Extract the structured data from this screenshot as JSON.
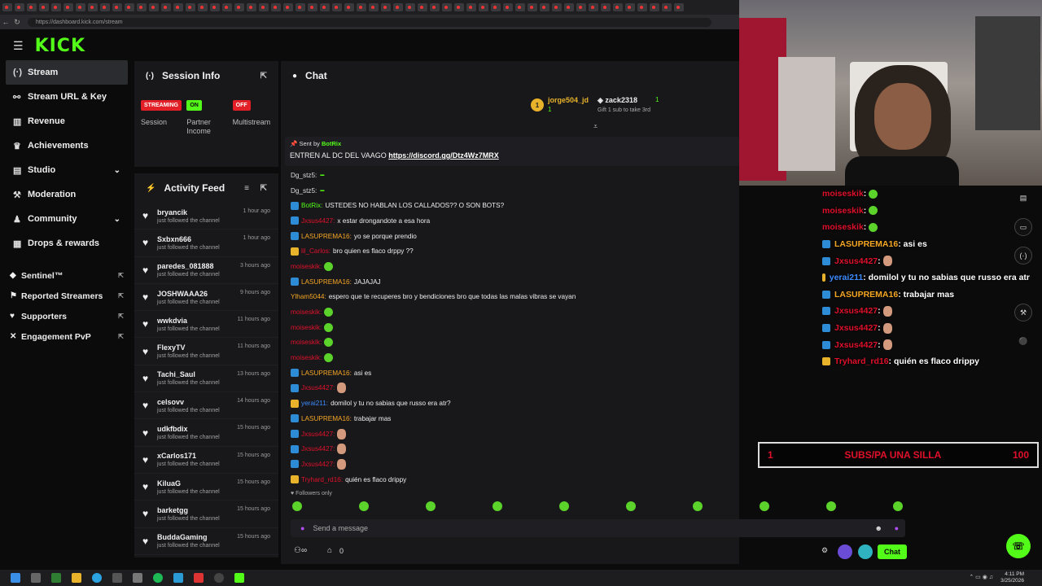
{
  "browser": {
    "url": "https://dashboard.kick.com/stream"
  },
  "brand": {
    "logo": "KICK",
    "accent": "#53fc18"
  },
  "sidebar": {
    "items": [
      {
        "label": "Stream",
        "icon": "stream-icon",
        "active": true
      },
      {
        "label": "Stream URL & Key",
        "icon": "link-icon"
      },
      {
        "label": "Revenue",
        "icon": "revenue-icon"
      },
      {
        "label": "Achievements",
        "icon": "trophy-icon"
      },
      {
        "label": "Studio",
        "icon": "studio-icon",
        "expandable": true
      },
      {
        "label": "Moderation",
        "icon": "hammer-icon"
      },
      {
        "label": "Community",
        "icon": "community-icon",
        "expandable": true
      },
      {
        "label": "Drops & rewards",
        "icon": "drops-icon"
      }
    ],
    "external": [
      {
        "label": "Sentinel™",
        "icon": "shield-icon"
      },
      {
        "label": "Reported Streamers",
        "icon": "report-icon"
      },
      {
        "label": "Supporters",
        "icon": "heart-icon"
      },
      {
        "label": "Engagement PvP",
        "icon": "pvp-icon"
      }
    ]
  },
  "session": {
    "title": "Session Info",
    "badges": [
      {
        "badge": "STREAMING",
        "label": "Session",
        "color": "#e21f26"
      },
      {
        "badge": "ON",
        "label": "Partner Income",
        "color": "#53fc18"
      },
      {
        "badge": "OFF",
        "label": "Multistream",
        "color": "#e21f26"
      }
    ]
  },
  "activity": {
    "title": "Activity Feed",
    "action": "just followed the channel",
    "rows": [
      {
        "name": "bryancik",
        "time": "1 hour ago"
      },
      {
        "name": "Sxbxn666",
        "time": "1 hour ago"
      },
      {
        "name": "paredes_081888",
        "time": "3 hours ago"
      },
      {
        "name": "JOSHWAAA26",
        "time": "9 hours ago"
      },
      {
        "name": "wwkdvia",
        "time": "11 hours ago"
      },
      {
        "name": "FlexyTV",
        "time": "11 hours ago"
      },
      {
        "name": "Tachi_Saul",
        "time": "13 hours ago"
      },
      {
        "name": "celsovv",
        "time": "14 hours ago"
      },
      {
        "name": "udkfbdix",
        "time": "15 hours ago"
      },
      {
        "name": "xCarlos171",
        "time": "15 hours ago"
      },
      {
        "name": "KiluaG",
        "time": "15 hours ago"
      },
      {
        "name": "barketgg",
        "time": "15 hours ago"
      },
      {
        "name": "BuddaGaming",
        "time": "15 hours ago"
      }
    ]
  },
  "chat": {
    "title": "Chat",
    "top_gifters": [
      {
        "rank": "1",
        "name": "jorge504_jd",
        "count": "1"
      },
      {
        "name": "zack2318",
        "count": "1",
        "note": "Gift 1 sub to take 3rd"
      }
    ],
    "pinned": {
      "sent_by": "Sent by",
      "author": "BotRix",
      "text": "ENTREN AL DC DEL VAAGO",
      "link": "https://discord.gg/Dtz4Wz7MRX"
    },
    "messages": [
      {
        "user": "Dg_stz5:",
        "color": "#ddd",
        "text": "",
        "badge": "",
        "emote": "tag"
      },
      {
        "user": "Dg_stz5:",
        "color": "#ddd",
        "text": "",
        "badge": "",
        "emote": "apaga"
      },
      {
        "user": "BotRix:",
        "color": "#53fc18",
        "text": "USTEDES NO HABLAN LOS CALLADOS?? O SON BOTS?",
        "badge": "#2e8bd6"
      },
      {
        "user": "Jxsus4427:",
        "color": "#e0102a",
        "text": "x estar drongandote a esa hora",
        "badge": "#2e8bd6"
      },
      {
        "user": "LASUPREMA16:",
        "color": "#f5a623",
        "text": "yo se porque prendio",
        "badge": "#2e8bd6"
      },
      {
        "user": "lil_Carlos:",
        "color": "#e0102a",
        "text": "bro quien es flaco drppy ??",
        "badge": "#e8b22a"
      },
      {
        "user": "moiseskik:",
        "color": "#e0102a",
        "text": "",
        "badge": "",
        "emote": "green"
      },
      {
        "user": "LASUPREMA16:",
        "color": "#f5a623",
        "text": "JAJAJAJ",
        "badge": "#2e8bd6"
      },
      {
        "user": "Ylham5044:",
        "color": "#f5a623",
        "text": "espero que te recuperes bro y bendiciones bro que todas las malas vibras se vayan",
        "badge": ""
      },
      {
        "user": "moiseskik:",
        "color": "#e0102a",
        "text": "",
        "badge": "",
        "emote": "green"
      },
      {
        "user": "moiseskik:",
        "color": "#e0102a",
        "text": "",
        "badge": "",
        "emote": "green"
      },
      {
        "user": "moiseskik:",
        "color": "#e0102a",
        "text": "",
        "badge": "",
        "emote": "green"
      },
      {
        "user": "moiseskik:",
        "color": "#e0102a",
        "text": "",
        "badge": "",
        "emote": "green"
      },
      {
        "user": "LASUPREMA16:",
        "color": "#f5a623",
        "text": "asi es",
        "badge": "#2e8bd6"
      },
      {
        "user": "Jxsus4427:",
        "color": "#e0102a",
        "text": "",
        "badge": "#2e8bd6",
        "emote": "face"
      },
      {
        "user": "yerai211:",
        "color": "#3d8bff",
        "text": "domilol y tu no sabias que russo era atr?",
        "badge": "#e8b22a"
      },
      {
        "user": "LASUPREMA16:",
        "color": "#f5a623",
        "text": "trabajar mas",
        "badge": "#2e8bd6"
      },
      {
        "user": "Jxsus4427:",
        "color": "#e0102a",
        "text": "",
        "badge": "#2e8bd6",
        "emote": "face"
      },
      {
        "user": "Jxsus4427:",
        "color": "#e0102a",
        "text": "",
        "badge": "#2e8bd6",
        "emote": "face"
      },
      {
        "user": "Jxsus4427:",
        "color": "#e0102a",
        "text": "",
        "badge": "#2e8bd6",
        "emote": "face"
      },
      {
        "user": "Tryhard_rd16:",
        "color": "#e0102a",
        "text": "quién es flaco drippy",
        "badge": "#e8b22a"
      }
    ],
    "followers_only": "Followers only",
    "placeholder": "Send a message",
    "viewers": "0",
    "send_label": "Chat"
  },
  "overlay": {
    "messages": [
      {
        "user": "moiseskik",
        "color": "#e0102a",
        "text": ": ",
        "badge": "",
        "emote": "green"
      },
      {
        "user": "moiseskik",
        "color": "#e0102a",
        "text": ": ",
        "badge": "",
        "emote": "green"
      },
      {
        "user": "moiseskik",
        "color": "#e0102a",
        "text": ": ",
        "badge": "",
        "emote": "green"
      },
      {
        "user": "LASUPREMA16",
        "color": "#f5a623",
        "text": " : asi es",
        "badge": "#2e8bd6"
      },
      {
        "user": "Jxsus4427",
        "color": "#e0102a",
        "text": " : ",
        "badge": "#2e8bd6",
        "emote": "face"
      },
      {
        "user": "yerai211",
        "color": "#3d8bff",
        "text": " : domilol y tu no sabias que russo era atr",
        "badge": "#e8b22a"
      },
      {
        "user": "LASUPREMA16",
        "color": "#f5a623",
        "text": " : trabajar mas",
        "badge": "#2e8bd6"
      },
      {
        "user": "Jxsus4427",
        "color": "#e0102a",
        "text": " : ",
        "badge": "#2e8bd6",
        "emote": "face"
      },
      {
        "user": "Jxsus4427",
        "color": "#e0102a",
        "text": " : ",
        "badge": "#2e8bd6",
        "emote": "face"
      },
      {
        "user": "Jxsus4427",
        "color": "#e0102a",
        "text": " : ",
        "badge": "#2e8bd6",
        "emote": "face"
      },
      {
        "user": "Tryhard_rd16",
        "color": "#e0102a",
        "text": " : quién es flaco drippy",
        "badge": "#e8b22a"
      }
    ],
    "goal": {
      "left": "1",
      "label": "SUBS/PA UNA SILLA",
      "right": "100"
    }
  },
  "taskbar": {
    "time": "4:11 PM",
    "date": "3/25/2026"
  }
}
